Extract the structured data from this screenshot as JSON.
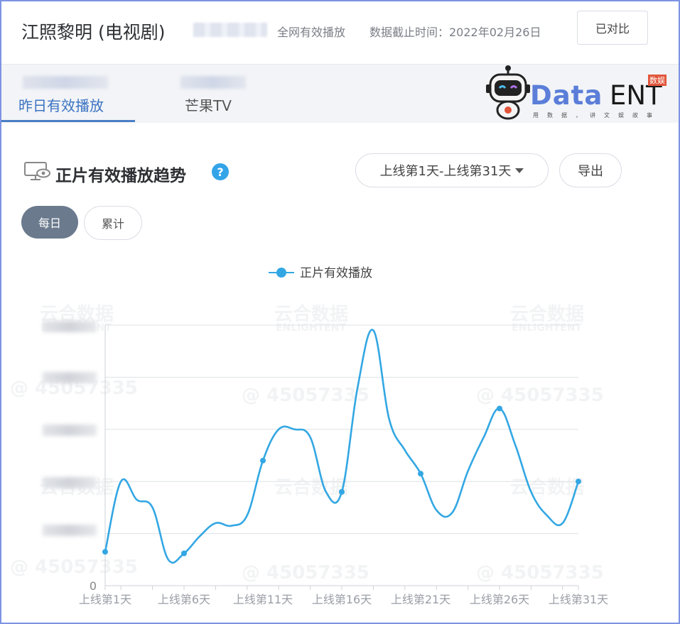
{
  "header": {
    "title": "江照黎明 (电视剧)",
    "scope_label": "全网有效播放",
    "date_label": "数据截止时间：2022年02月26日",
    "compare_button": "已对比"
  },
  "tabs": [
    {
      "label": "昨日有效播放",
      "active": true
    },
    {
      "label": "芒果TV",
      "active": false
    }
  ],
  "logo": {
    "data_text": "Data",
    "ent_text": "ENT",
    "tag": "数娱",
    "slogan": "用数据，讲文娱故事"
  },
  "section": {
    "title": "正片有效播放趋势",
    "help": "?",
    "range_select": "上线第1天-上线第31天",
    "export_button": "导出"
  },
  "toggles": {
    "daily": "每日",
    "cumulative": "累计"
  },
  "watermarks": {
    "brand": "云合数据",
    "brand_en": "ENLIGHTENT",
    "id": "@ 45057335"
  },
  "colors": {
    "line": "#33a7e3",
    "accent": "#4a7ec5",
    "help": "#34a4e8"
  },
  "chart_data": {
    "type": "line",
    "legend": "正片有效播放",
    "legend_position": "top-center",
    "grid": true,
    "x_ticks": [
      "上线第1天",
      "上线第6天",
      "上线第11天",
      "上线第16天",
      "上线第21天",
      "上线第26天",
      "上线第31天"
    ],
    "y_tick_visible": "0",
    "ylim": [
      0,
      5
    ],
    "x": [
      1,
      2,
      3,
      4,
      5,
      6,
      7,
      8,
      9,
      10,
      11,
      12,
      13,
      14,
      15,
      16,
      17,
      18,
      19,
      20,
      21,
      22,
      23,
      24,
      25,
      26,
      27,
      28,
      29,
      30,
      31
    ],
    "series": [
      {
        "name": "正片有效播放",
        "values": [
          0.65,
          2.0,
          1.65,
          1.5,
          0.5,
          0.62,
          0.95,
          1.2,
          1.15,
          1.35,
          2.4,
          3.0,
          3.0,
          2.85,
          1.8,
          1.8,
          3.8,
          4.9,
          3.2,
          2.6,
          2.15,
          1.45,
          1.4,
          2.2,
          2.85,
          3.4,
          2.7,
          1.8,
          1.35,
          1.2,
          2.0
        ]
      }
    ],
    "markers_at": [
      1,
      6,
      11,
      16,
      21,
      26,
      31
    ]
  }
}
